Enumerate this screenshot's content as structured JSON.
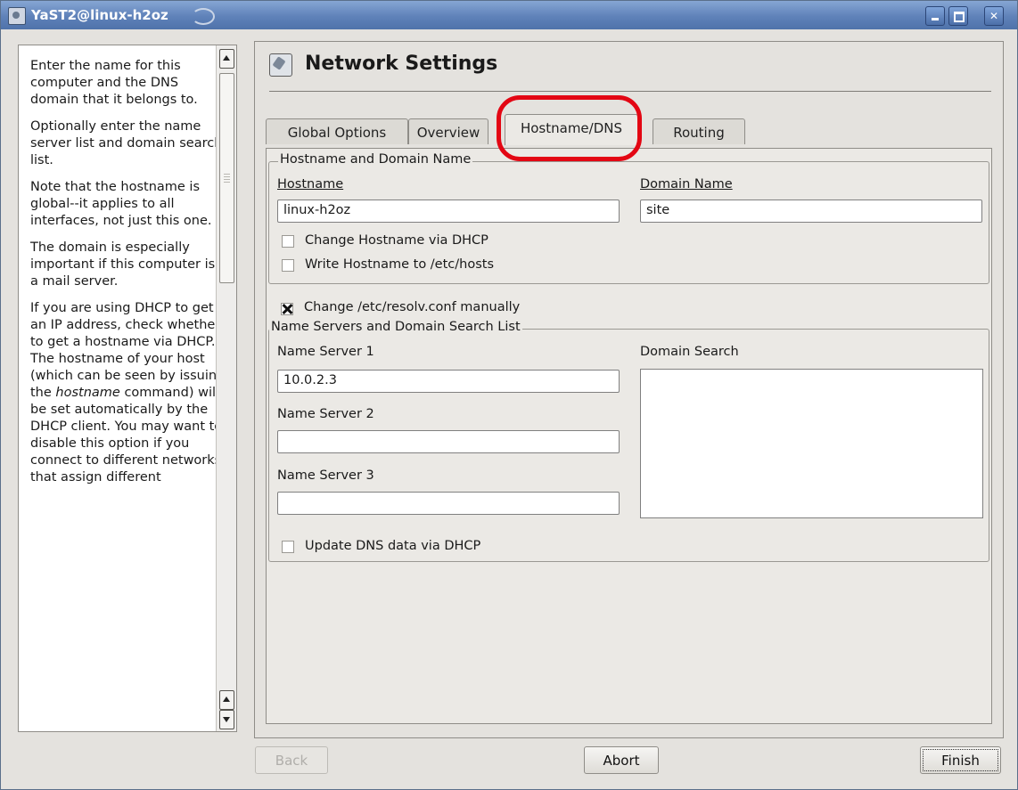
{
  "window": {
    "title": "YaST2@linux-h2oz"
  },
  "help": {
    "paragraphs": [
      "Enter the name for this computer and the DNS domain that it belongs to.",
      "Optionally enter the name server list and domain search list.",
      "Note that the hostname is global--it applies to all interfaces, not just this one.",
      "The domain is especially important if this computer is a mail server."
    ],
    "p5": {
      "before": "If you are using DHCP to get an IP address, check whether to get a hostname via DHCP. The hostname of your host (which can be seen by issuing the ",
      "command": "hostname",
      "after": " command) will be set automatically by the DHCP client. You may want to disable this option if you connect to different networks that assign different"
    }
  },
  "page": {
    "title": "Network Settings"
  },
  "tabs": [
    "Global Options",
    "Overview",
    "Hostname/DNS",
    "Routing"
  ],
  "active_tab": "Hostname/DNS",
  "hostname_group": {
    "title": "Hostname and Domain Name",
    "hostname_label": "Hostname",
    "hostname_value": "linux-h2oz",
    "domain_label": "Domain Name",
    "domain_value": "site",
    "change_via_dhcp_label": "Change Hostname via DHCP",
    "change_via_dhcp_checked": false,
    "write_hosts_label": "Write Hostname to /etc/hosts",
    "write_hosts_checked": false
  },
  "resolv": {
    "label": "Change /etc/resolv.conf manually",
    "checked": true
  },
  "nameserver_group": {
    "title": "Name Servers and Domain Search List",
    "ns1_label": "Name Server 1",
    "ns1_value": "10.0.2.3",
    "ns2_label": "Name Server 2",
    "ns2_value": "",
    "ns3_label": "Name Server 3",
    "ns3_value": "",
    "domain_search_label": "Domain Search",
    "update_dns_label": "Update DNS data via DHCP",
    "update_dns_checked": false
  },
  "buttons": {
    "back": "Back",
    "abort": "Abort",
    "finish": "Finish"
  },
  "colors": {
    "highlight": "#e30613",
    "titlebar": "#5f82b9"
  }
}
